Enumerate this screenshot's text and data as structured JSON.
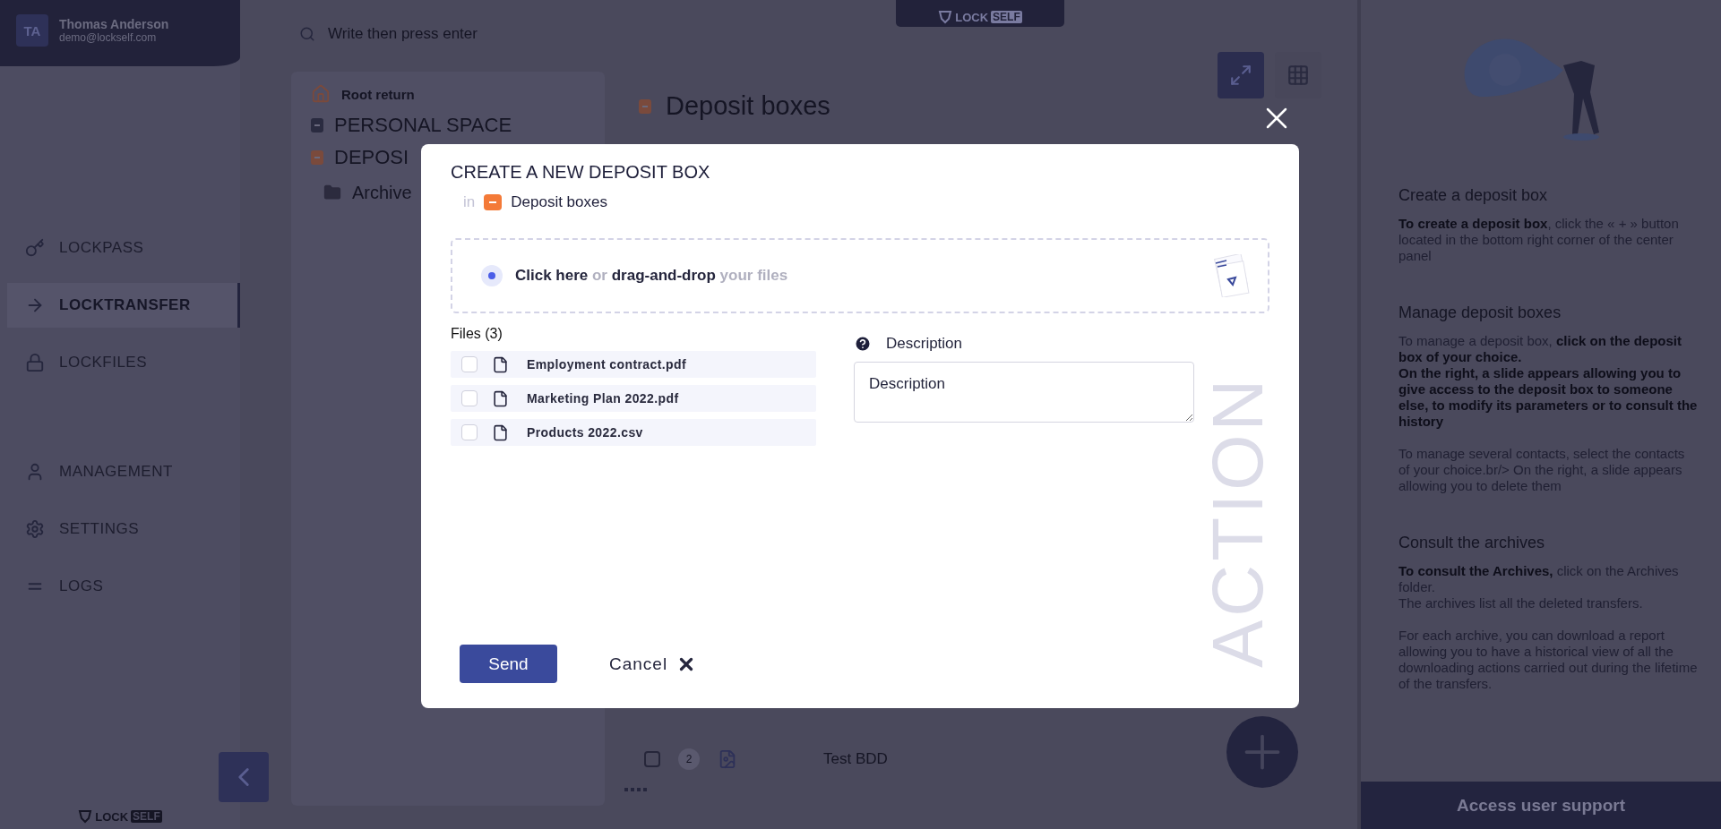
{
  "sidebar": {
    "user": {
      "initials": "TA",
      "name": "Thomas Anderson",
      "email": "demo@lockself.com"
    },
    "nav_groups": [
      [
        {
          "label": "LOCKPASS",
          "selected": false
        },
        {
          "label": "LOCKTRANSFER",
          "selected": true
        },
        {
          "label": "LOCKFILES",
          "selected": false
        }
      ],
      [
        {
          "label": "MANAGEMENT",
          "selected": false
        },
        {
          "label": "SETTINGS",
          "selected": false
        },
        {
          "label": "LOGS",
          "selected": false
        }
      ]
    ],
    "logo": {
      "left": "LOCK",
      "right": "SELF"
    }
  },
  "top_tab": {
    "logo": {
      "left": "LOCK",
      "right": "SELF"
    }
  },
  "search": {
    "placeholder": "Write then press enter"
  },
  "tree": {
    "root_return": "Root return",
    "items": [
      {
        "label": "PERSONAL SPACE",
        "kind": "space",
        "color": "#2a2b40"
      },
      {
        "label": "DEPOSI",
        "kind": "space",
        "color": "#7a4a3c"
      },
      {
        "label": "Archive",
        "kind": "folder",
        "color": "#2c2b3e"
      }
    ]
  },
  "center": {
    "title": "Deposit boxes",
    "rows": [
      {
        "count": "2",
        "name": "Test BDD",
        "checked": false
      }
    ]
  },
  "modal": {
    "title": "CREATE A NEW DEPOSIT BOX",
    "location_prefix": "in",
    "location": "Deposit boxes",
    "dropzone": "**Click here** or **drag-and-drop** your files",
    "files_title": "Files (3)",
    "files": [
      {
        "name": "Employment contract.pdf",
        "checked": false
      },
      {
        "name": "Marketing Plan 2022.pdf",
        "checked": false
      },
      {
        "name": "Products 2022.csv",
        "checked": false
      }
    ],
    "description": {
      "label": "Description",
      "placeholder": "Description"
    },
    "send": "Send",
    "cancel": "Cancel",
    "watermark": "ACTION"
  },
  "help": {
    "sections": [
      {
        "heading": "Create a deposit box",
        "paragraphs": [
          [
            "**To create a deposit box**, click the « + » button located in the bottom right corner of the center panel"
          ]
        ]
      },
      {
        "heading": "Manage deposit boxes",
        "paragraphs": [
          [
            "To manage a deposit box, **click on the deposit box of your choice.**",
            "**On the right, a slide appears allowing you to give access to the deposit box to someone else, to modify its parameters or to consult the history**"
          ],
          [
            "To manage several contacts, select the contacts of your choice.br/> On the right, a slide appears allowing you to delete them"
          ]
        ]
      },
      {
        "heading": "Consult the archives",
        "paragraphs": [
          [
            "**To consult the Archives,** click on the Archives folder.",
            "The archives list all the deleted transfers."
          ],
          [
            "For each archive, you can download a report allowing you to have a historical view of all the downloading actions carried out during the lifetime of the transfers."
          ]
        ]
      }
    ],
    "support": "Access user support"
  }
}
